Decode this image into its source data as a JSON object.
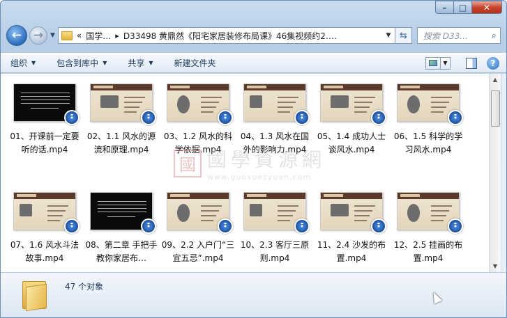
{
  "window": {
    "minimize_label": "–",
    "maximize_label": "□",
    "close_label": "✕"
  },
  "nav": {
    "back_icon": "back-arrow-icon",
    "forward_icon": "forward-arrow-icon",
    "address": {
      "history_glyph": "«",
      "crumb1": "国学…",
      "sep": "▸",
      "crumb2": "D33498 黄鼎然《阳宅家居装修布局课》46集视频约2…."
    },
    "search_placeholder": "搜索 D33…"
  },
  "toolbar": {
    "organize": "组织",
    "include": "包含到库中",
    "share": "共享",
    "new_folder": "新建文件夹"
  },
  "files": [
    {
      "label": "01、开课前一定要听的话.mp4",
      "thumb": "dark"
    },
    {
      "label": "02、1.1 风水的源流和原理.mp4",
      "thumb": "light"
    },
    {
      "label": "03、1.2 风水的科学依据.mp4",
      "thumb": "light"
    },
    {
      "label": "04、1.3 风水在国外的影响力.mp4",
      "thumb": "light"
    },
    {
      "label": "05、1.4 成功人士谈风水.mp4",
      "thumb": "light"
    },
    {
      "label": "06、1.5 科学的学习风水.mp4",
      "thumb": "light"
    },
    {
      "label": "07、1.6 风水斗法故事.mp4",
      "thumb": "light"
    },
    {
      "label": "08、第二章 手把手教你家居布…",
      "thumb": "dark"
    },
    {
      "label": "09、2.2 入户门“三宜五忌”.mp4",
      "thumb": "light"
    },
    {
      "label": "10、2.3 客厅三原则.mp4",
      "thumb": "light"
    },
    {
      "label": "11、2.4 沙发的布置.mp4",
      "thumb": "light"
    },
    {
      "label": "12、2.5 挂画的布置.mp4",
      "thumb": "light"
    }
  ],
  "watermark": {
    "seal": "國",
    "text": "國學資源網",
    "url": "www.guoxuezyuan.com"
  },
  "status": {
    "count": "47 个对象"
  }
}
